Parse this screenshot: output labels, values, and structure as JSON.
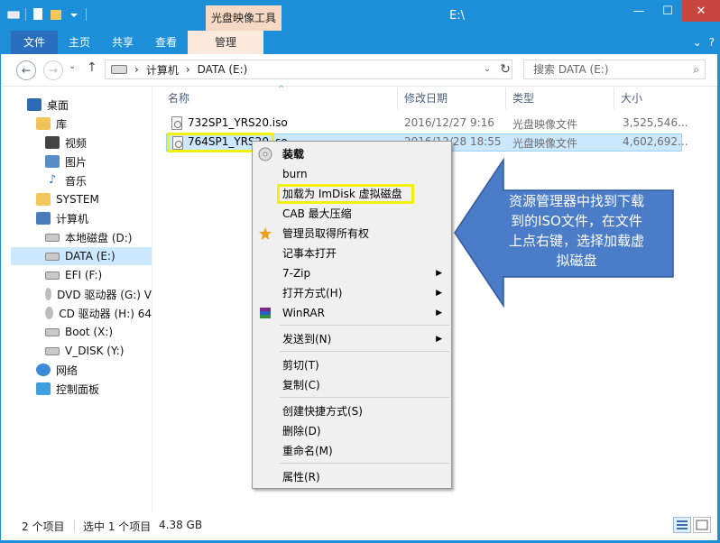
{
  "window": {
    "title": "E:\\",
    "context_tab_group": "光盘映像工具",
    "minimize": "—",
    "maximize": "☐",
    "close": "✕"
  },
  "ribbon": {
    "tabs": [
      "文件",
      "主页",
      "共享",
      "查看"
    ],
    "context_tab": "管理",
    "collapse": "⌄",
    "help": "?"
  },
  "address": {
    "back": "←",
    "forward": "→",
    "recent": "⌄",
    "up": "↑",
    "crumbs": [
      "计算机",
      "DATA (E:)"
    ],
    "crumb_sep": "›",
    "dropdown": "⌄",
    "refresh": "↻",
    "search_placeholder": "搜索 DATA (E:)",
    "search_icon": "⌕"
  },
  "nav": {
    "desktop": "桌面",
    "libraries": "库",
    "videos": "视频",
    "pictures": "图片",
    "music": "音乐",
    "system": "SYSTEM",
    "computer": "计算机",
    "drive_d": "本地磁盘 (D:)",
    "drive_e": "DATA (E:)",
    "drive_f": "EFI (F:)",
    "drive_g": "DVD 驱动器 (G:) V",
    "drive_h": "CD 驱动器 (H:) 64",
    "drive_x": "Boot (X:)",
    "drive_y": "V_DISK (Y:)",
    "network": "网络",
    "control_panel": "控制面板"
  },
  "columns": {
    "name": "名称",
    "modified": "修改日期",
    "type": "类型",
    "size": "大小",
    "sort_indicator": "^"
  },
  "files": [
    {
      "name": "732SP1_YRS20.iso",
      "modified": "2016/12/27 9:16",
      "type": "光盘映像文件",
      "size": "3,525,546..."
    },
    {
      "name": "764SP1_YRS20.iso",
      "modified": "2016/12/28 18:55",
      "type": "光盘映像文件",
      "size": "4,602,692..."
    }
  ],
  "context_menu": {
    "mount": "装载",
    "burn": "burn",
    "imdisk": "加载为 ImDisk 虚拟磁盘",
    "cab": "CAB 最大压缩",
    "admin": "管理员取得所有权",
    "notepad": "记事本打开",
    "sevenzip": "7-Zip",
    "open_with": "打开方式(H)",
    "winrar": "WinRAR",
    "send_to": "发送到(N)",
    "cut": "剪切(T)",
    "copy": "复制(C)",
    "shortcut": "创建快捷方式(S)",
    "delete": "删除(D)",
    "rename": "重命名(M)",
    "properties": "属性(R)",
    "submenu_arrow": "▶"
  },
  "callout": {
    "text": "资源管理器中找到下载到的ISO文件，在文件上点右键，选择加载虚拟磁盘",
    "color": "#4a7cc7"
  },
  "status": {
    "item_count": "2 个项目",
    "selected": "选中 1 个项目",
    "selected_size": "4.38 GB"
  },
  "colors": {
    "accent": "#1c8fd8",
    "highlight": "#f3f00e",
    "selection": "#cce8ff"
  }
}
